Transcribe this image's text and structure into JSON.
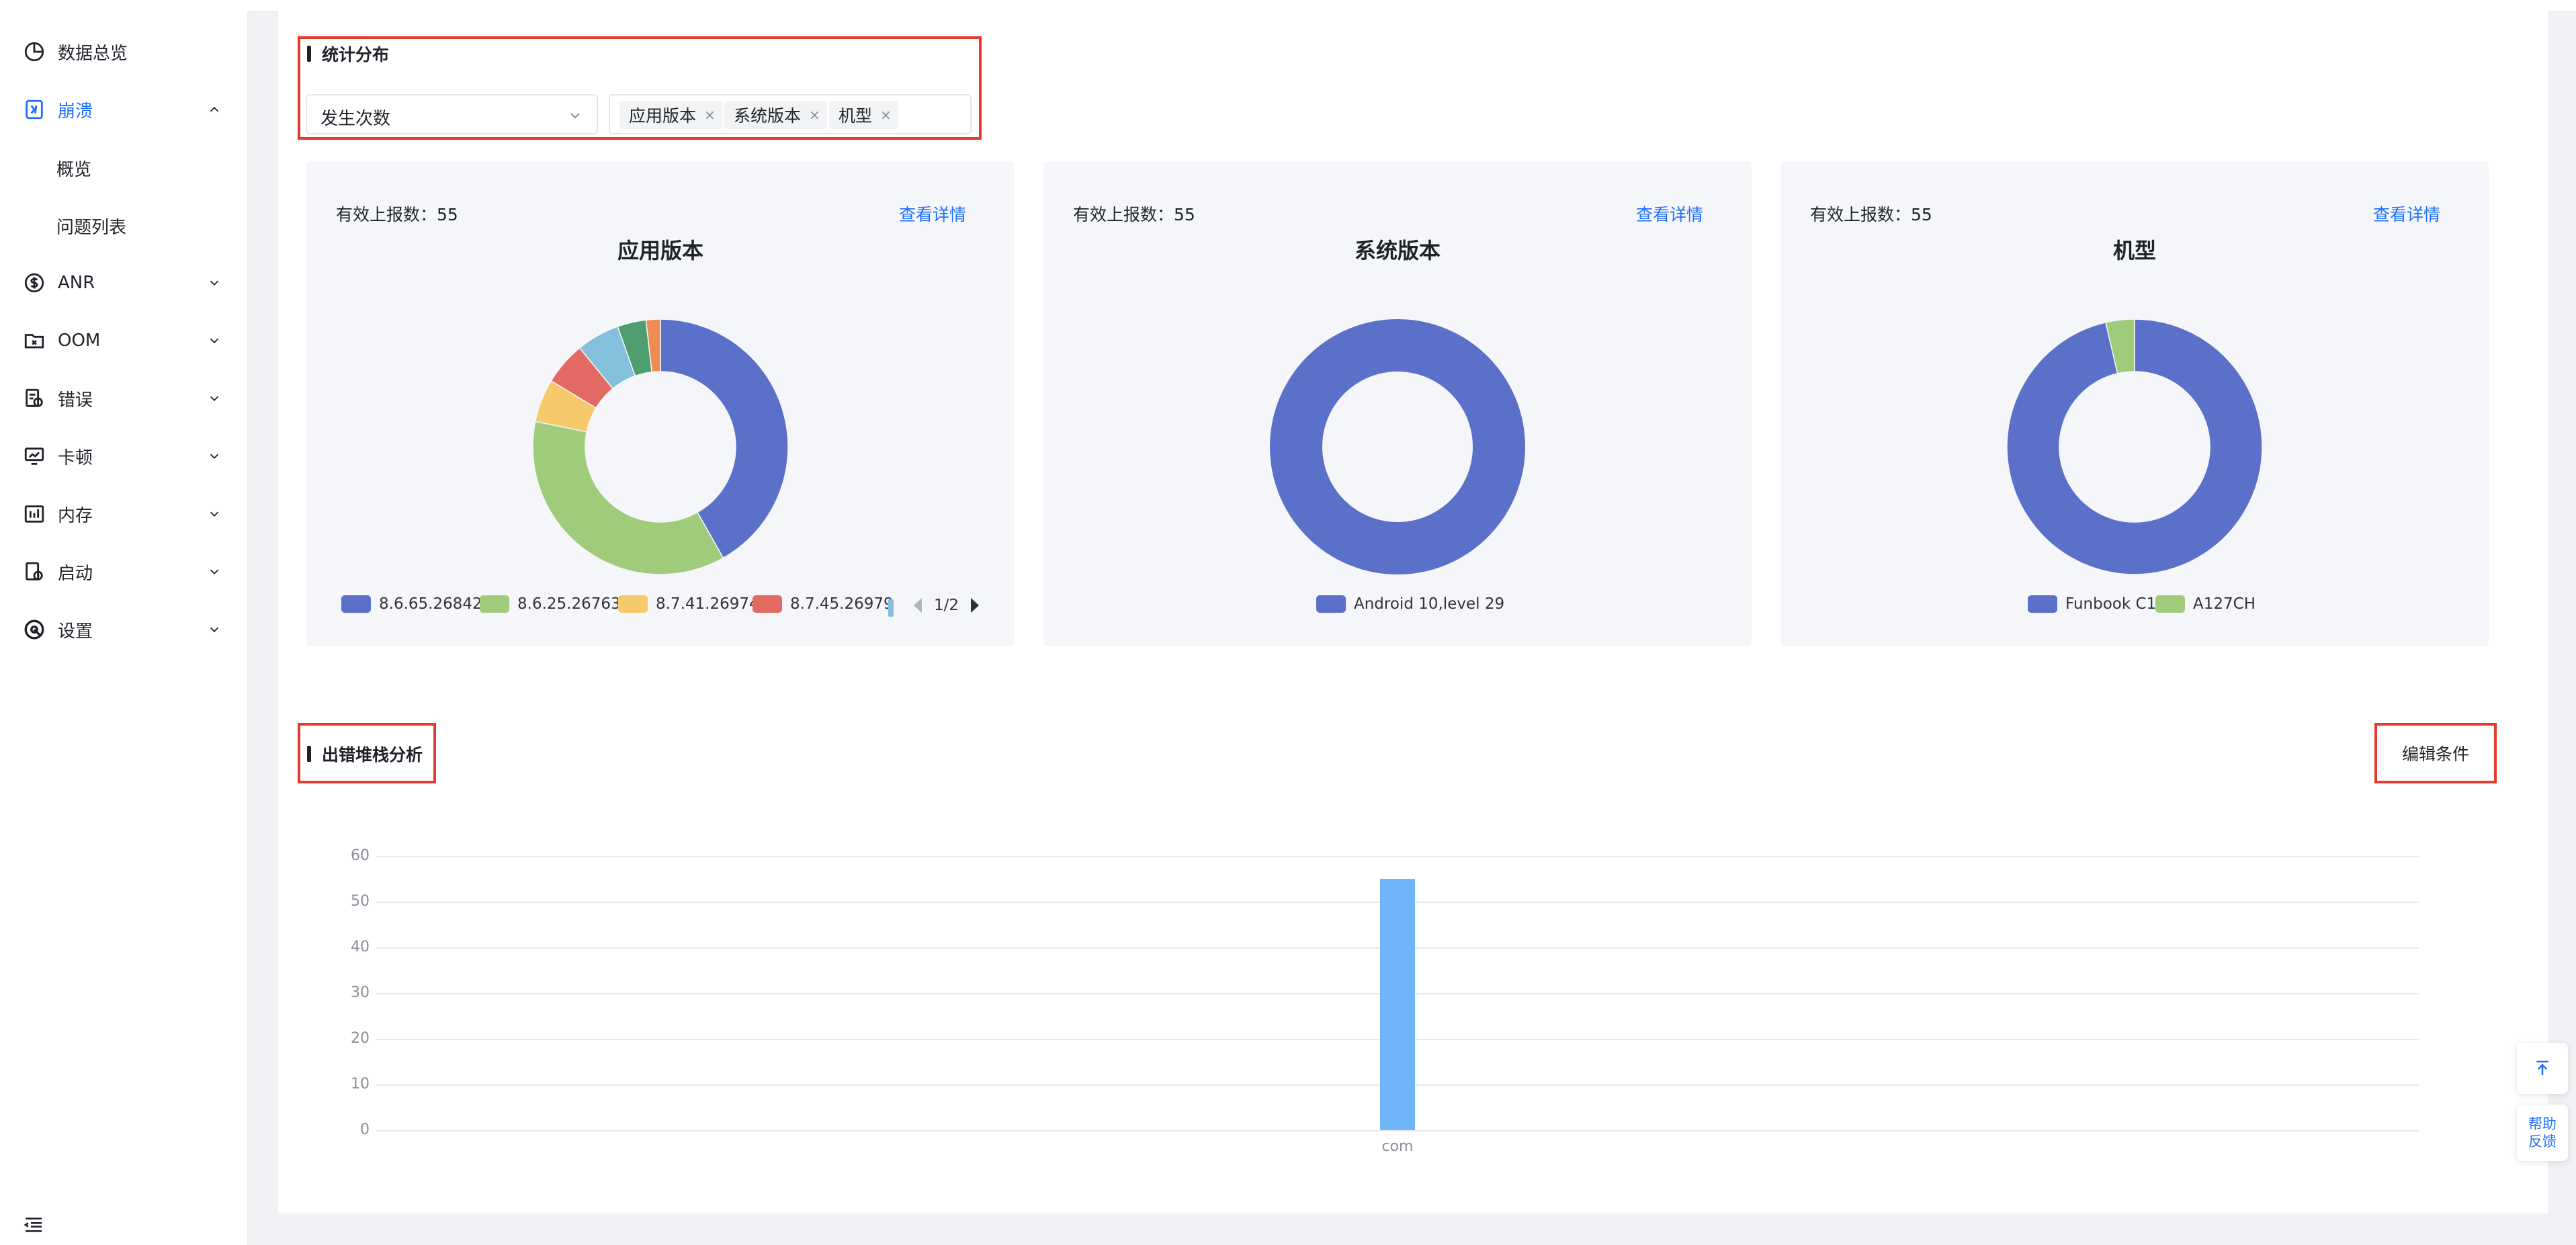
{
  "sidebar": {
    "items": [
      {
        "label": "数据总览",
        "icon": "pie-chart-icon"
      },
      {
        "label": "崩溃",
        "icon": "crash-icon",
        "expanded": true,
        "active": true
      },
      {
        "label": "ANR",
        "icon": "dollar-circle-icon"
      },
      {
        "label": "OOM",
        "icon": "folder-icon"
      },
      {
        "label": "错误",
        "icon": "error-doc-icon"
      },
      {
        "label": "卡顿",
        "icon": "monitor-icon"
      },
      {
        "label": "内存",
        "icon": "memory-icon"
      },
      {
        "label": "启动",
        "icon": "launch-icon"
      },
      {
        "label": "设置",
        "icon": "settings-icon"
      }
    ],
    "sub_items": [
      "概览",
      "问题列表"
    ]
  },
  "stats": {
    "title": "统计分布",
    "metric_select": "发生次数",
    "tags": [
      "应用版本",
      "系统版本",
      "机型"
    ]
  },
  "cards": [
    {
      "count_label": "有效上报数：",
      "count": "55",
      "detail_label": "查看详情",
      "title": "应用版本",
      "legend": [
        "8.6.65.26842",
        "8.6.25.26763",
        "8.7.41.26974",
        "8.7.45.26979"
      ],
      "pager": "1/2"
    },
    {
      "count_label": "有效上报数：",
      "count": "55",
      "detail_label": "查看详情",
      "title": "系统版本",
      "legend": [
        "Android 10,level 29"
      ]
    },
    {
      "count_label": "有效上报数：",
      "count": "55",
      "detail_label": "查看详情",
      "title": "机型",
      "legend": [
        "Funbook C1",
        "A127CH"
      ]
    }
  ],
  "stack": {
    "title": "出错堆栈分析",
    "edit_label": "编辑条件"
  },
  "chart_data": [
    {
      "type": "pie",
      "title": "应用版本",
      "donut": true,
      "slices": [
        {
          "name": "8.6.65.26842",
          "value": 23,
          "color": "#5b70c8"
        },
        {
          "name": "8.6.25.26763",
          "value": 20,
          "color": "#9fcb7a"
        },
        {
          "name": "8.7.41.26974",
          "value": 3,
          "color": "#f6c96a"
        },
        {
          "name": "8.7.45.26979",
          "value": 3,
          "color": "#e36a62"
        },
        {
          "name": "",
          "value": 3,
          "color": "#84c0dc"
        },
        {
          "name": "",
          "value": 2,
          "color": "#4e9e72"
        },
        {
          "name": "",
          "value": 1,
          "color": "#ef8c53"
        }
      ]
    },
    {
      "type": "pie",
      "title": "系统版本",
      "donut": true,
      "slices": [
        {
          "name": "Android 10,level 29",
          "value": 55,
          "color": "#5b70c8"
        }
      ]
    },
    {
      "type": "pie",
      "title": "机型",
      "donut": true,
      "slices": [
        {
          "name": "Funbook C1",
          "value": 53,
          "color": "#5b70c8"
        },
        {
          "name": "A127CH",
          "value": 2,
          "color": "#9fcb7a"
        }
      ]
    },
    {
      "type": "bar",
      "title": "",
      "categories": [
        "com"
      ],
      "values": [
        55
      ],
      "ylim": [
        0,
        60
      ],
      "yticks": [
        0,
        10,
        20,
        30,
        40,
        50,
        60
      ],
      "grid": true,
      "color": "#6fb5f9"
    }
  ],
  "float": {
    "help_line1": "帮助",
    "help_line2": "反馈"
  }
}
